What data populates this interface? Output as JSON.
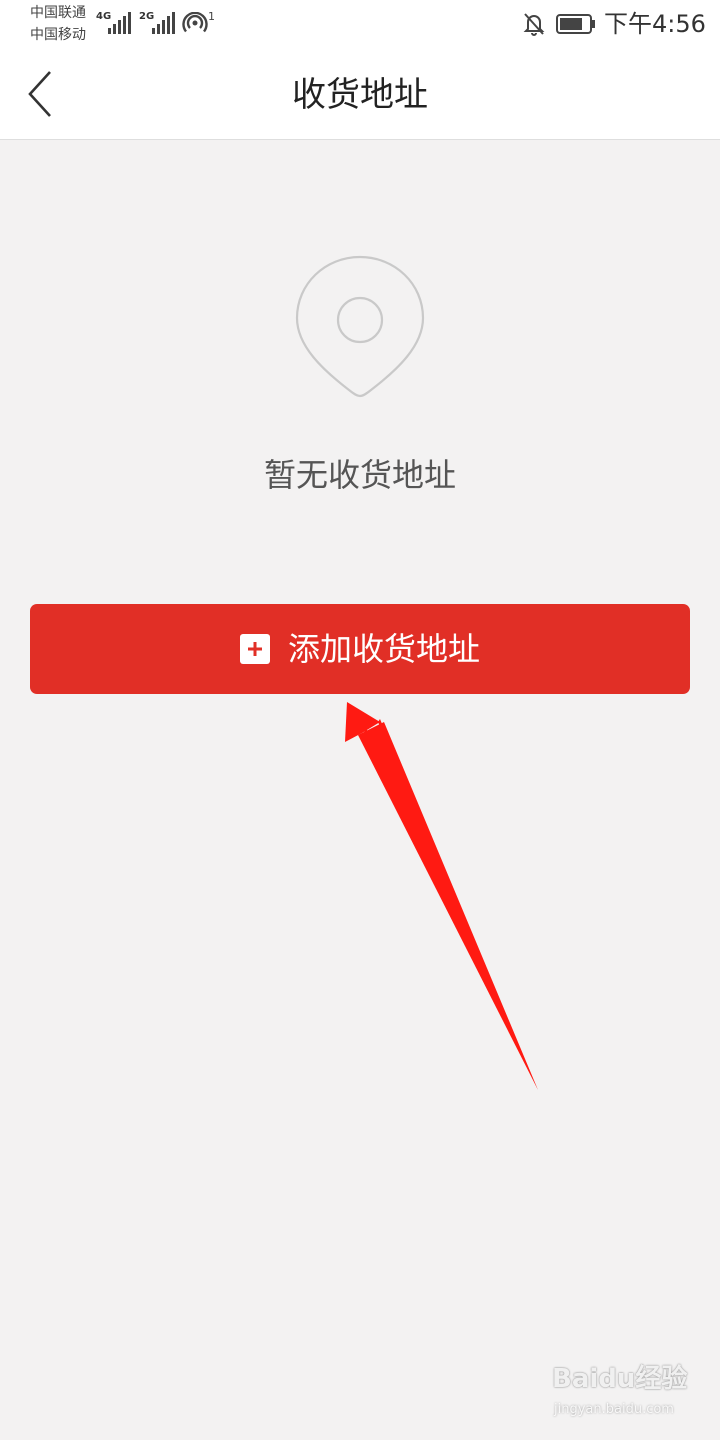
{
  "status_bar": {
    "carrier_1": "中国联通",
    "carrier_2": "中国移动",
    "network_1": "4G",
    "network_2": "2G",
    "hotspot_count": "1",
    "time": "下午4:56",
    "icons": [
      "signal-icon",
      "hotspot-icon",
      "bell-muted-icon",
      "battery-icon"
    ]
  },
  "header": {
    "title": "收货地址",
    "back_icon": "chevron-left-icon"
  },
  "empty_state": {
    "icon": "location-pin-icon",
    "message": "暂无收货地址"
  },
  "add_button": {
    "label": "添加收货地址",
    "icon": "plus-square-icon",
    "color": "#e12f26"
  },
  "watermark": {
    "brand": "Baidu经验",
    "url": "jingyan.baidu.com"
  },
  "colors": {
    "background": "#f3f2f2",
    "header_bg": "#ffffff",
    "accent": "#e12f26",
    "annotation_arrow": "#ff1a12"
  }
}
